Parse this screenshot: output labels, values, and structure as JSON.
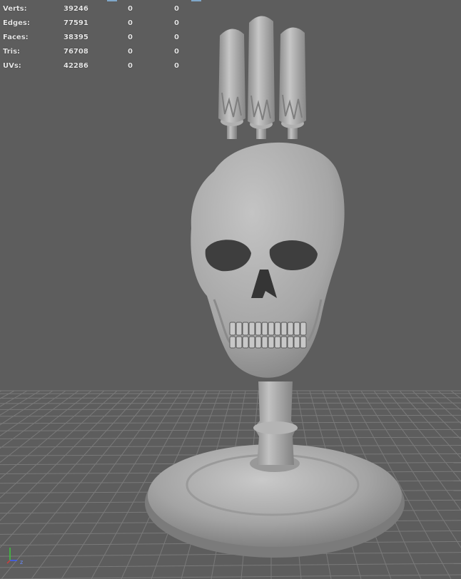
{
  "hud": {
    "rows": [
      {
        "label": "Verts:",
        "total": "39246",
        "selected": "0",
        "components": "0"
      },
      {
        "label": "Edges:",
        "total": "77591",
        "selected": "0",
        "components": "0"
      },
      {
        "label": "Faces:",
        "total": "38395",
        "selected": "0",
        "components": "0"
      },
      {
        "label": "Tris:",
        "total": "76708",
        "selected": "0",
        "components": "0"
      },
      {
        "label": "UVs:",
        "total": "42286",
        "selected": "0",
        "components": "0"
      }
    ]
  },
  "axis": {
    "label": "z"
  },
  "colors": {
    "background": "#5d5d5d",
    "grid": "#777777",
    "model": "#a9a9a9",
    "hud_text": "#e8e8e8",
    "axis_x": "#d23c3c",
    "axis_y": "#3cc83c",
    "axis_z": "#3c5cff"
  }
}
